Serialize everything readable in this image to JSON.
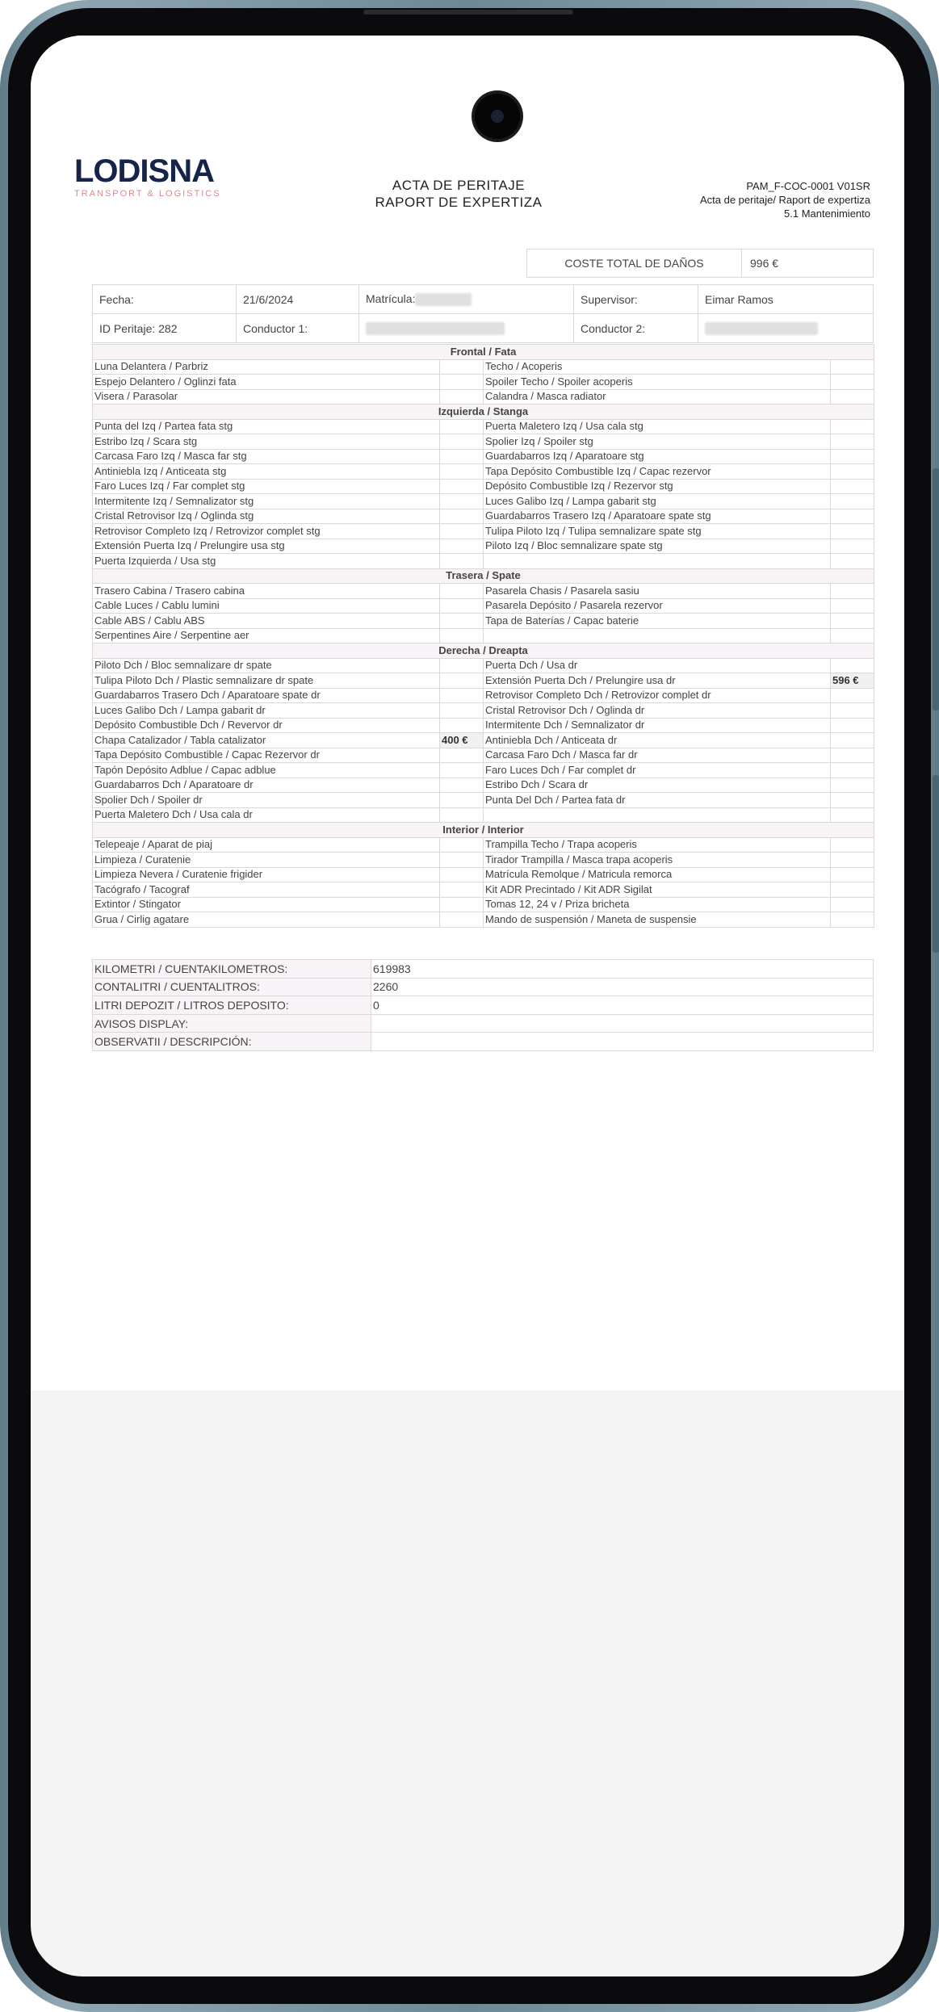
{
  "header": {
    "logo_text": "LODISNA",
    "logo_sub": "TRANSPORT & LOGISTICS",
    "title_line1": "ACTA DE PERITAJE",
    "title_line2": "RAPORT DE EXPERTIZA",
    "code": "PAM_F-COC-0001 V01SR",
    "code_line2": "Acta de peritaje/ Raport de expertiza",
    "code_line3": "5.1 Mantenimiento"
  },
  "cost": {
    "label": "COSTE TOTAL DE DAÑOS",
    "value": "996 €"
  },
  "info": {
    "fecha_label": "Fecha:",
    "fecha_value": "21/6/2024",
    "matricula_label": "Matrícula:",
    "supervisor_label": "Supervisor:",
    "supervisor_value": "Eimar Ramos",
    "id_label": "ID Peritaje: 282",
    "conductor1_label": "Conductor 1:",
    "conductor2_label": "Conductor 2:"
  },
  "sections": [
    {
      "title": "Frontal / Fata",
      "rows": [
        {
          "l": "Luna Delantera / Parbriz",
          "lv": "",
          "r": "Techo / Acoperis",
          "rv": ""
        },
        {
          "l": "Espejo Delantero / Oglinzi fata",
          "lv": "",
          "r": "Spoiler Techo / Spoiler acoperis",
          "rv": ""
        },
        {
          "l": "Visera / Parasolar",
          "lv": "",
          "r": "Calandra / Masca radiator",
          "rv": ""
        }
      ]
    },
    {
      "title": "Izquierda / Stanga",
      "rows": [
        {
          "l": "Punta del Izq / Partea fata stg",
          "lv": "",
          "r": "Puerta Maletero Izq / Usa cala stg",
          "rv": ""
        },
        {
          "l": "Estribo Izq / Scara stg",
          "lv": "",
          "r": "Spolier Izq / Spoiler stg",
          "rv": ""
        },
        {
          "l": "Carcasa Faro Izq / Masca far stg",
          "lv": "",
          "r": "Guardabarros Izq / Aparatoare stg",
          "rv": ""
        },
        {
          "l": "Antiniebla Izq / Anticeata stg",
          "lv": "",
          "r": "Tapa Depósito Combustible Izq / Capac rezervor",
          "rv": ""
        },
        {
          "l": "Faro Luces Izq / Far complet stg",
          "lv": "",
          "r": "Depósito Combustible Izq / Rezervor stg",
          "rv": ""
        },
        {
          "l": "Intermitente Izq / Semnalizator stg",
          "lv": "",
          "r": "Luces Galibo Izq / Lampa gabarit stg",
          "rv": ""
        },
        {
          "l": "Cristal Retrovisor Izq / Oglinda stg",
          "lv": "",
          "r": "Guardabarros Trasero Izq / Aparatoare spate stg",
          "rv": ""
        },
        {
          "l": "Retrovisor Completo Izq / Retrovizor complet stg",
          "lv": "",
          "r": "Tulipa Piloto Izq / Tulipa semnalizare spate stg",
          "rv": ""
        },
        {
          "l": "Extensión Puerta Izq / Prelungire usa stg",
          "lv": "",
          "r": "Piloto Izq / Bloc semnalizare spate stg",
          "rv": ""
        },
        {
          "l": "Puerta Izquierda / Usa stg",
          "lv": "",
          "r": "",
          "rv": ""
        }
      ]
    },
    {
      "title": "Trasera / Spate",
      "rows": [
        {
          "l": "Trasero Cabina / Trasero cabina",
          "lv": "",
          "r": "Pasarela Chasis / Pasarela sasiu",
          "rv": ""
        },
        {
          "l": "Cable Luces / Cablu lumini",
          "lv": "",
          "r": "Pasarela Depósito / Pasarela rezervor",
          "rv": ""
        },
        {
          "l": "Cable ABS / Cablu ABS",
          "lv": "",
          "r": "Tapa de Baterías / Capac baterie",
          "rv": ""
        },
        {
          "l": "Serpentines Aire / Serpentine aer",
          "lv": "",
          "r": "",
          "rv": ""
        }
      ]
    },
    {
      "title": "Derecha / Dreapta",
      "rows": [
        {
          "l": "Piloto Dch / Bloc semnalizare dr spate",
          "lv": "",
          "r": "Puerta Dch / Usa dr",
          "rv": ""
        },
        {
          "l": "Tulipa Piloto Dch / Plastic semnalizare dr spate",
          "lv": "",
          "r": "Extensión Puerta Dch / Prelungire usa dr",
          "rv": "596 €"
        },
        {
          "l": "Guardabarros Trasero Dch / Aparatoare spate dr",
          "lv": "",
          "r": "Retrovisor Completo Dch / Retrovizor complet dr",
          "rv": ""
        },
        {
          "l": "Luces Galibo Dch / Lampa gabarit dr",
          "lv": "",
          "r": "Cristal Retrovisor Dch / Oglinda dr",
          "rv": ""
        },
        {
          "l": "Depósito Combustible Dch / Revervor dr",
          "lv": "",
          "r": "Intermitente Dch / Semnalizator dr",
          "rv": ""
        },
        {
          "l": "Chapa Catalizador / Tabla catalizator",
          "lv": "400 €",
          "r": "Antiniebla Dch / Anticeata dr",
          "rv": ""
        },
        {
          "l": "Tapa Depósito Combustible / Capac Rezervor dr",
          "lv": "",
          "r": "Carcasa Faro Dch / Masca far dr",
          "rv": ""
        },
        {
          "l": "Tapón Depósito Adblue / Capac adblue",
          "lv": "",
          "r": "Faro Luces Dch / Far complet dr",
          "rv": ""
        },
        {
          "l": "Guardabarros Dch / Aparatoare dr",
          "lv": "",
          "r": "Estribo Dch / Scara dr",
          "rv": ""
        },
        {
          "l": "Spolier Dch / Spoiler dr",
          "lv": "",
          "r": "Punta Del Dch / Partea fata dr",
          "rv": ""
        },
        {
          "l": "Puerta Maletero Dch / Usa cala dr",
          "lv": "",
          "r": "",
          "rv": ""
        }
      ]
    },
    {
      "title": "Interior / Interior",
      "rows": [
        {
          "l": "Telepeaje / Aparat de piaj",
          "lv": "",
          "r": "Trampilla Techo / Trapa acoperis",
          "rv": ""
        },
        {
          "l": "Limpieza / Curatenie",
          "lv": "",
          "r": "Tirador Trampilla / Masca trapa acoperis",
          "rv": ""
        },
        {
          "l": "Limpieza Nevera / Curatenie frigider",
          "lv": "",
          "r": "Matrícula Remolque / Matricula remorca",
          "rv": ""
        },
        {
          "l": "Tacógrafo / Tacograf",
          "lv": "",
          "r": "Kit ADR Precintado / Kit ADR Sigilat",
          "rv": ""
        },
        {
          "l": "Extintor / Stingator",
          "lv": "",
          "r": "Tomas 12, 24 v / Priza bricheta",
          "rv": ""
        },
        {
          "l": "Grua / Cirlig agatare",
          "lv": "",
          "r": "Mando de suspensión / Maneta de suspensie",
          "rv": ""
        }
      ]
    }
  ],
  "summary": [
    {
      "label": "KILOMETRI / CUENTAKILOMETROS:",
      "value": "619983"
    },
    {
      "label": "CONTALITRI / CUENTALITROS:",
      "value": "2260"
    },
    {
      "label": "LITRI DEPOZIT / LITROS DEPOSITO:",
      "value": "0"
    },
    {
      "label": "AVISOS DISPLAY:",
      "value": ""
    },
    {
      "label": "OBSERVATII / DESCRIPCIÓN:",
      "value": ""
    }
  ]
}
